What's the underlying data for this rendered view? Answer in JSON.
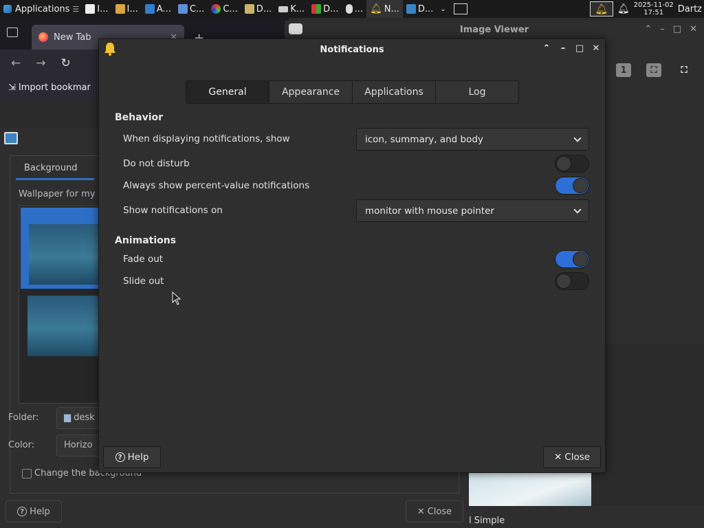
{
  "panel": {
    "applications_label": "Applications",
    "tasks": [
      "I...",
      "I...",
      "A...",
      "C...",
      "C...",
      "D...",
      "K...",
      "D...",
      "...",
      "N...",
      "D..."
    ],
    "clock_date": "2025-11-02",
    "clock_time": "17:51",
    "user": "Dartz"
  },
  "browser": {
    "tab_title": "New Tab",
    "bookmarks_label": "Import bookmar"
  },
  "viewer": {
    "title": "Image Viewer",
    "badge_1": "1",
    "bottom_label": "l Simple"
  },
  "desktop": {
    "tab_background": "Background",
    "wallpaper_label": "Wallpaper for my",
    "folder_label": "Folder:",
    "folder_value": "desk",
    "color_label": "Color:",
    "color_value": "Horizo",
    "change_bg_label": "Change the background",
    "help": "Help",
    "close": "Close"
  },
  "dialog": {
    "title": "Notifications",
    "tabs": [
      "General",
      "Appearance",
      "Applications",
      "Log"
    ],
    "active_tab": "General",
    "behavior": {
      "heading": "Behavior",
      "show_label": "When displaying notifications, show",
      "show_value": "icon, summary, and body",
      "dnd_label": "Do not disturb",
      "dnd_on": false,
      "percent_label": "Always show percent-value notifications",
      "percent_on": true,
      "showon_label": "Show notifications on",
      "showon_value": "monitor with mouse pointer"
    },
    "animations": {
      "heading": "Animations",
      "fade_label": "Fade out",
      "fade_on": true,
      "slide_label": "Slide out",
      "slide_on": false
    },
    "help": "Help",
    "close": "Close"
  },
  "colors": {
    "accent": "#2d6fd6",
    "bell": "#f2c230"
  }
}
